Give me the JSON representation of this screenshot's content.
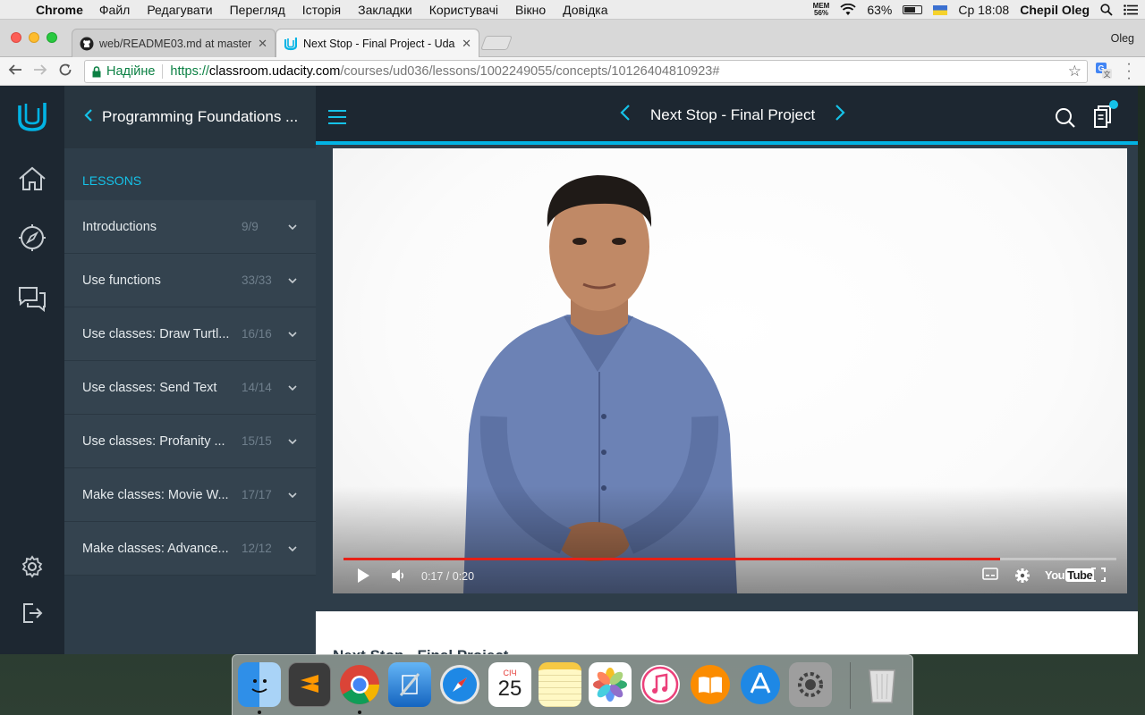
{
  "menubar": {
    "apple": "",
    "app_name": "Chrome",
    "items": [
      "Файл",
      "Редагувати",
      "Перегляд",
      "Історія",
      "Закладки",
      "Користувачі",
      "Вікно",
      "Довідка"
    ],
    "mem_label": "MEM",
    "mem_value": "56%",
    "battery": "63%",
    "clock": "Ср 18:08",
    "user": "Chepil Oleg"
  },
  "tabs": [
    {
      "title": "web/README03.md at master",
      "close": "✕",
      "icon": "github-icon"
    },
    {
      "title": "Next Stop - Final Project - Uda",
      "close": "✕",
      "icon": "udacity-icon"
    }
  ],
  "profile_name": "Oleg",
  "address_bar": {
    "secure_label": "Надійне",
    "url_scheme": "https://",
    "url_host": "classroom.udacity.com",
    "url_path": "/courses/ud036/lessons/1002249055/concepts/10126404810923#"
  },
  "sidebar": {
    "course_title": "Programming Foundations ...",
    "lessons_heading": "LESSONS",
    "lessons": [
      {
        "name": "Introductions",
        "count": "9/9"
      },
      {
        "name": "Use functions",
        "count": "33/33"
      },
      {
        "name": "Use classes: Draw Turtl...",
        "count": "16/16"
      },
      {
        "name": "Use classes: Send Text",
        "count": "14/14"
      },
      {
        "name": "Use classes: Profanity ...",
        "count": "15/15"
      },
      {
        "name": "Make classes: Movie W...",
        "count": "17/17"
      },
      {
        "name": "Make classes: Advance...",
        "count": "12/12"
      }
    ]
  },
  "header": {
    "concept_title": "Next Stop - Final Project"
  },
  "video": {
    "current_time": "0:17",
    "duration": "0:20",
    "time_display": "0:17 / 0:20",
    "progress_fraction": 0.85,
    "logo_text_a": "You",
    "logo_text_b": "Tube"
  },
  "content": {
    "title": "Next Stop - Final Project"
  },
  "dock": {
    "calendar_month": "СІЧ",
    "calendar_day": "25"
  },
  "colors": {
    "udacity_blue": "#02b3e4",
    "rail_bg": "#1d2731",
    "panel_bg": "#2e3d49",
    "progress_red": "#e62117"
  }
}
